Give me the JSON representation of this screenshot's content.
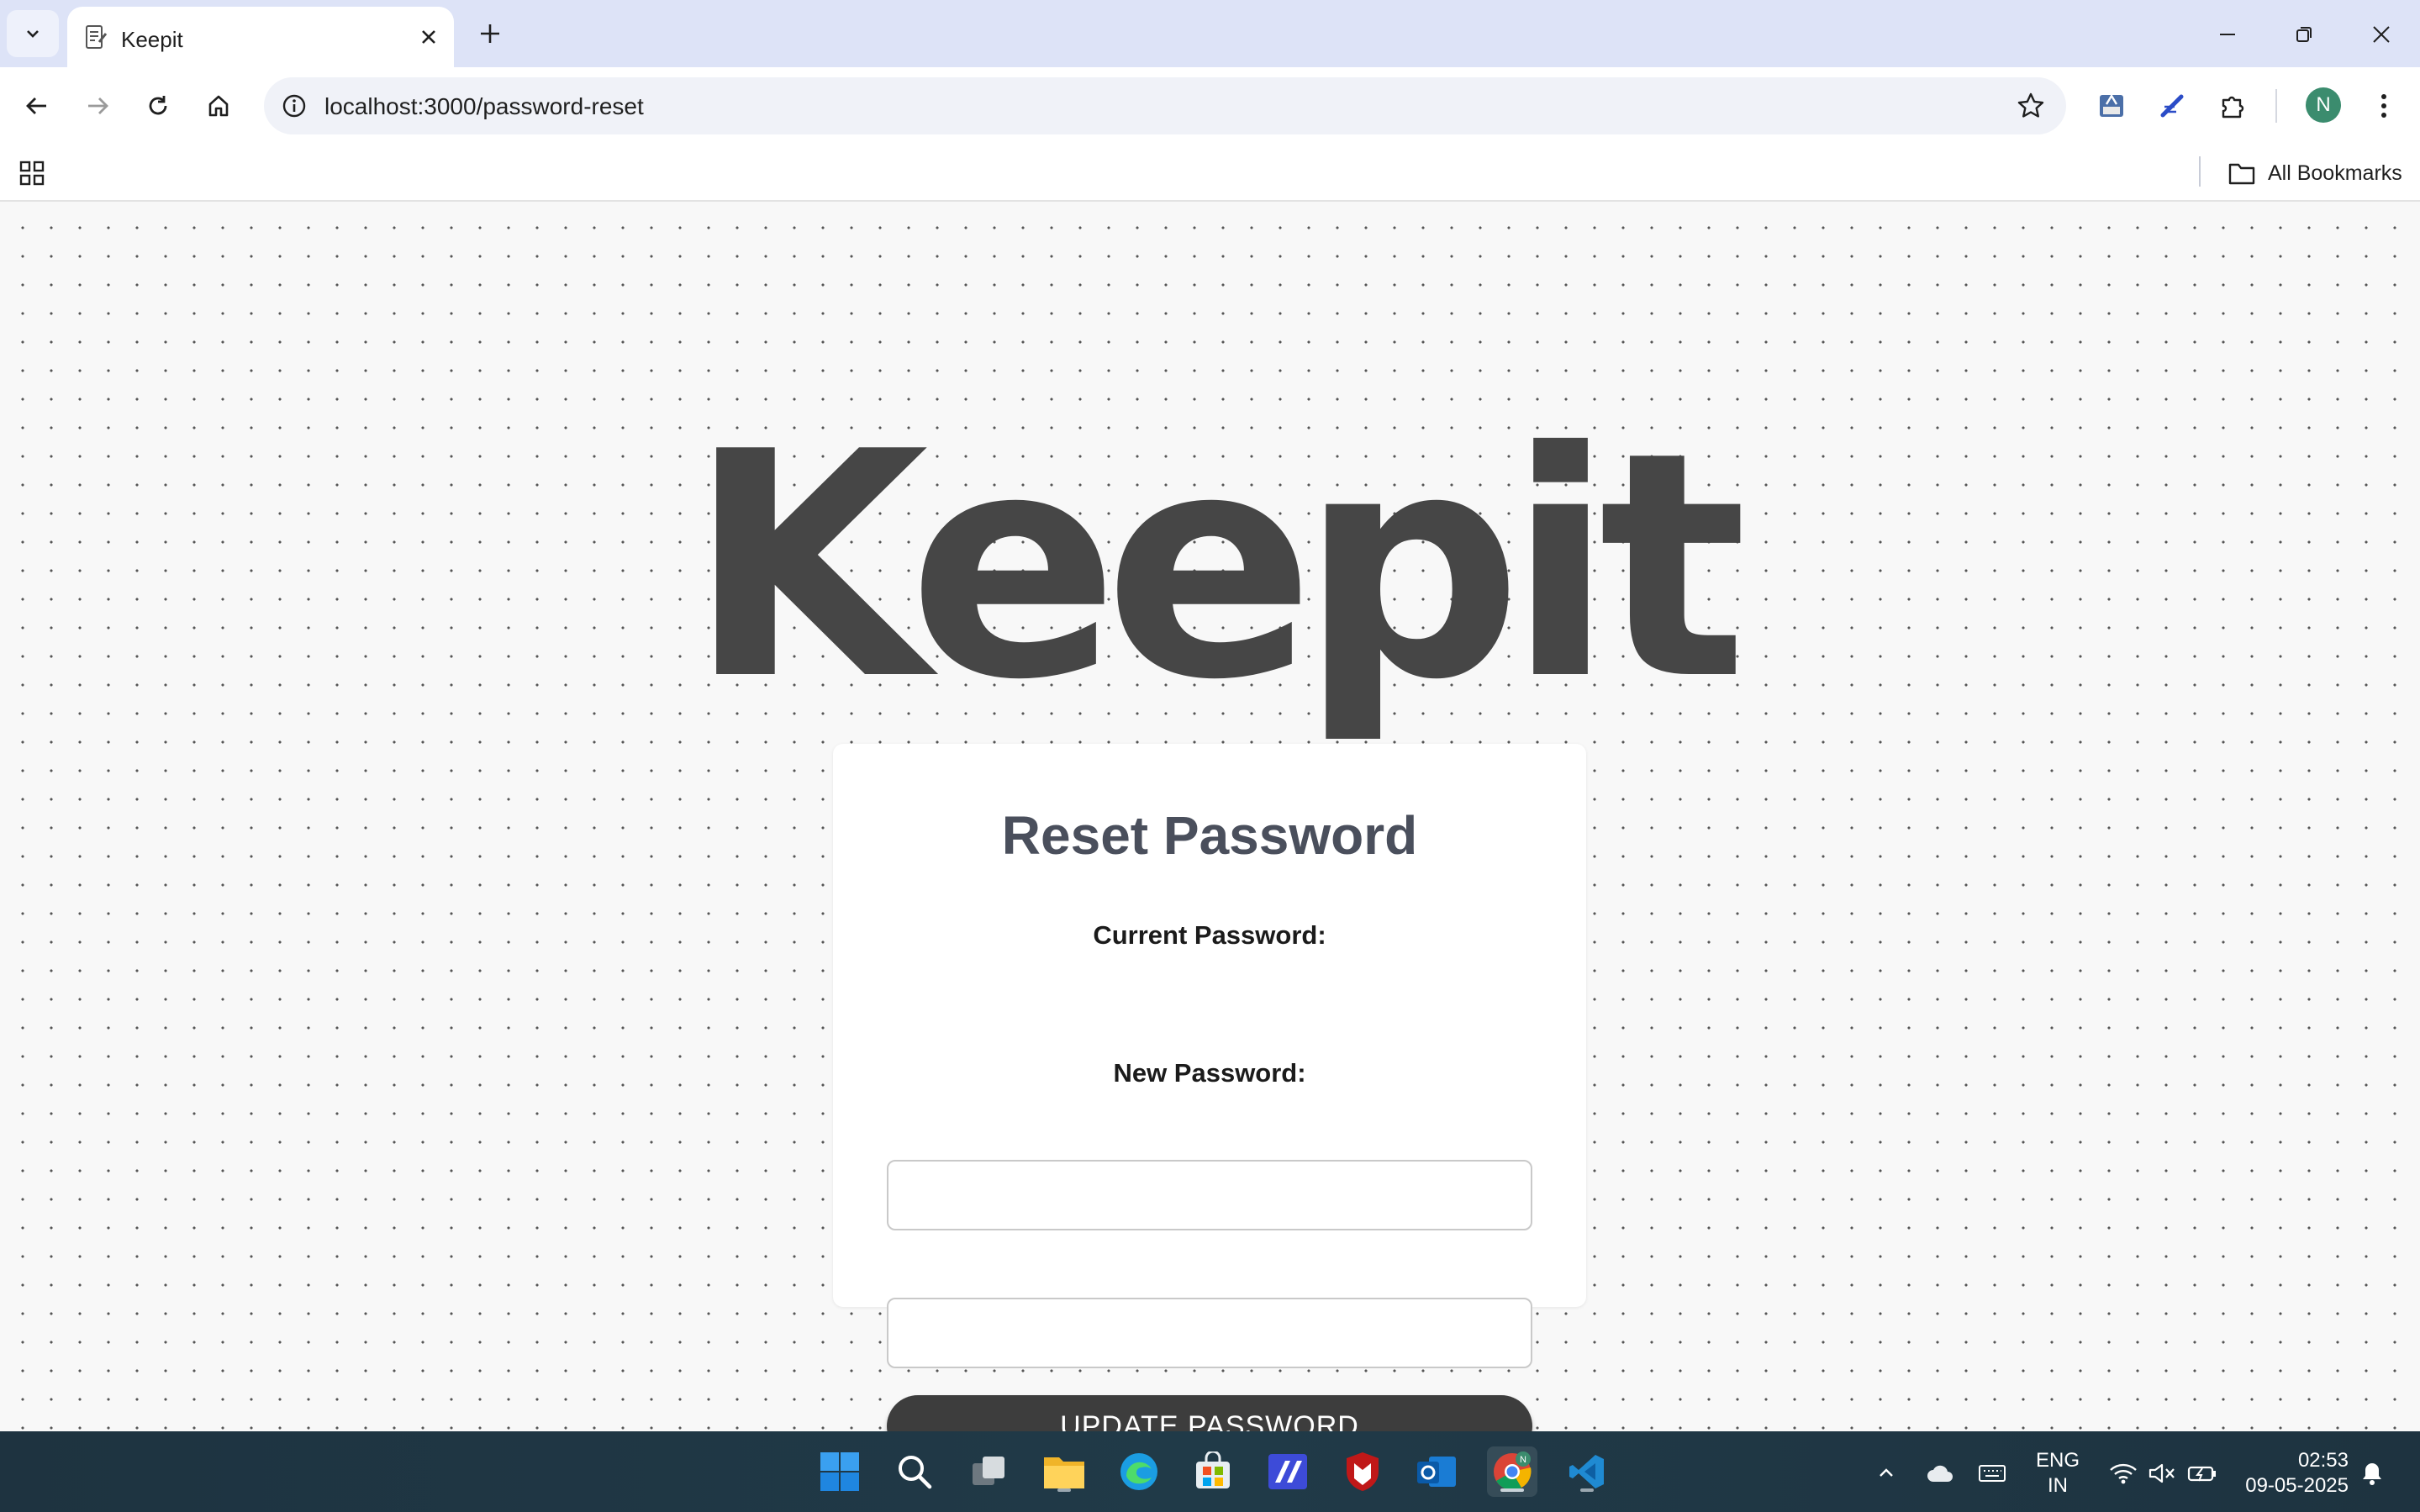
{
  "browser": {
    "tab_title": "Keepit",
    "url": "localhost:3000/password-reset",
    "profile_initial": "N",
    "bookmarks_label": "All Bookmarks"
  },
  "page": {
    "logo": "Keepit",
    "form": {
      "title": "Reset Password",
      "current_label": "Current Password:",
      "current_value": "",
      "new_label": "New Password:",
      "new_value": "",
      "submit_label": "UPDATE PASSWORD"
    }
  },
  "taskbar": {
    "apps": [
      "start-icon",
      "search-icon",
      "task-view-icon",
      "file-explorer-icon",
      "edge-icon",
      "store-icon",
      "app-icon",
      "mcafee-icon",
      "outlook-icon",
      "chrome-icon",
      "vscode-icon"
    ],
    "lang_line1": "ENG",
    "lang_line2": "IN",
    "time": "02:53",
    "date": "09-05-2025"
  },
  "colors": {
    "tabbar": "#dde3f7",
    "logo": "#464646",
    "button": "#3d3d3d",
    "title": "#4a4f5c"
  }
}
